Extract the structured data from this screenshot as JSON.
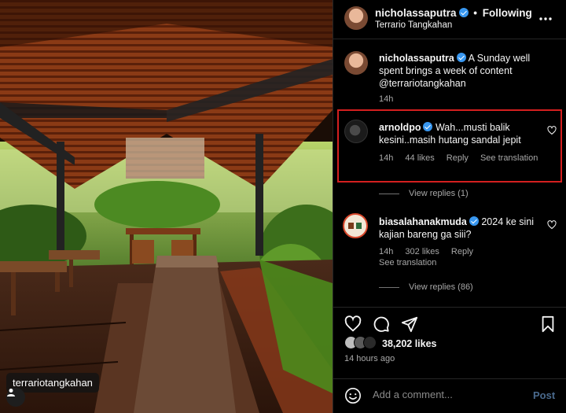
{
  "post": {
    "author": "nicholassaputra",
    "follow_label": "Following",
    "separator": "•",
    "location": "Terrario Tangkahan",
    "more_icon": "more-horizontal-icon",
    "tag_label": "terrariotangkahan"
  },
  "caption": {
    "username": "nicholassaputra",
    "text": "A Sunday well spent brings a week of content @terrariotangkahan",
    "time": "14h"
  },
  "comments": [
    {
      "username": "arnoldpo",
      "text": "Wah...musti balik kesini..masih hutang sandal jepit",
      "time": "14h",
      "likes": "44 likes",
      "reply": "Reply",
      "translate": "See translation",
      "view_replies": "View replies (1)"
    },
    {
      "username": "biasalahanakmuda",
      "text": "2024 ke sini kajian bareng ga siii?",
      "time": "14h",
      "likes": "302 likes",
      "reply": "Reply",
      "translate": "See translation",
      "view_replies": "View replies (86)"
    }
  ],
  "actions": {
    "like_icon": "heart-icon",
    "comment_icon": "comment-icon",
    "share_icon": "share-icon",
    "save_icon": "bookmark-icon"
  },
  "likes_count": "38,202 likes",
  "time_ago": "14 hours ago",
  "composer": {
    "placeholder": "Add a comment...",
    "post_label": "Post"
  },
  "colors": {
    "verified": "#3897f0",
    "highlight_border": "#d41f1f",
    "post_button": "#4a6a8d"
  }
}
